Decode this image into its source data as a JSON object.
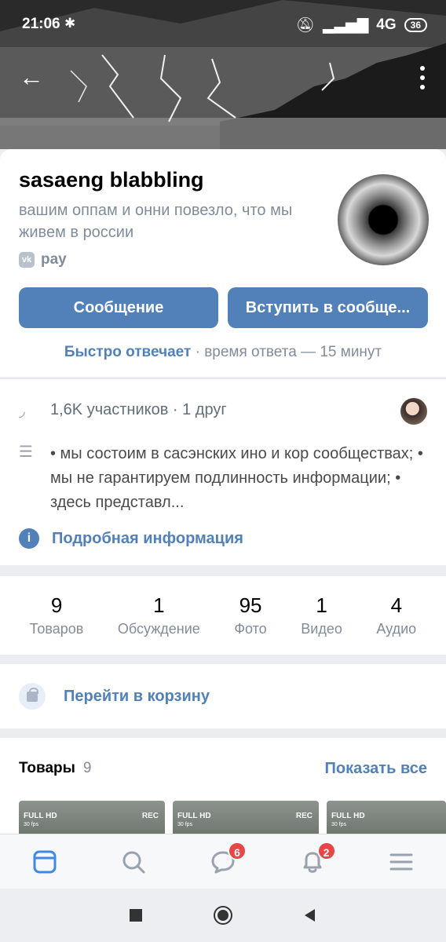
{
  "status_bar": {
    "time": "21:06",
    "network": "4G",
    "battery": "36"
  },
  "group": {
    "name": "sasaeng blabbling",
    "status": "вашим оппам и онни повезло, что мы живем в россии",
    "pay_label": "pay",
    "pay_logo": "vk"
  },
  "actions": {
    "message": "Сообщение",
    "join": "Вступить в сообще..."
  },
  "response": {
    "fast": "Быстро отвечает",
    "time": "· время ответа — 15 минут"
  },
  "info": {
    "members": "1,6K участников · 1 друг",
    "description": "• мы состоим в сасэнских ино и кор сообществах; • мы не гарантируем подлинность информации; • здесь представл...",
    "details": "Подробная информация"
  },
  "counters": [
    {
      "value": "9",
      "label": "Товаров"
    },
    {
      "value": "1",
      "label": "Обсуждение"
    },
    {
      "value": "95",
      "label": "Фото"
    },
    {
      "value": "1",
      "label": "Видео"
    },
    {
      "value": "4",
      "label": "Аудио"
    }
  ],
  "cart": {
    "label": "Перейти в корзину"
  },
  "products": {
    "title": "Товары",
    "count": "9",
    "show_all": "Показать все",
    "thumb": {
      "hd": "FULL HD",
      "fps": "30 fps",
      "rec": "REC"
    }
  },
  "bottom_nav": {
    "messages_badge": "6",
    "notifications_badge": "2"
  },
  "colors": {
    "accent": "#5181b8",
    "badge": "#e64646",
    "secondary_text": "#818c99"
  }
}
